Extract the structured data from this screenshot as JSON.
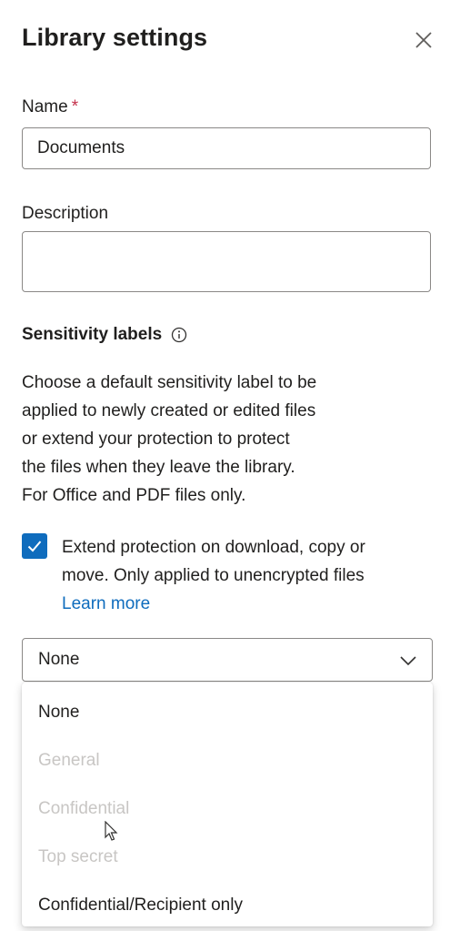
{
  "panel": {
    "title": "Library settings",
    "close_icon": "close-icon"
  },
  "name_field": {
    "label": "Name",
    "required_marker": "*",
    "value": "Documents"
  },
  "description_field": {
    "label": "Description",
    "value": "",
    "placeholder": ""
  },
  "sensitivity": {
    "heading": "Sensitivity labels",
    "info_icon": "info-icon",
    "description_lines": [
      "Choose a default sensitivity label to be",
      "applied to newly created or edited files",
      "or extend your protection to protect",
      "the files when they leave the library.",
      "For Office and PDF files only."
    ],
    "extend_checkbox": {
      "checked": true,
      "lines": [
        "Extend protection on download, copy or",
        "move. Only applied to unencrypted files"
      ],
      "link": "Learn more"
    },
    "dropdown": {
      "selected": "None",
      "options": [
        {
          "label": "None",
          "enabled": true
        },
        {
          "label": "General",
          "enabled": false
        },
        {
          "label": "Confidential",
          "enabled": false
        },
        {
          "label": "Top secret",
          "enabled": false
        },
        {
          "label": "Confidential/Recipient only",
          "enabled": true
        }
      ]
    }
  },
  "colors": {
    "accent": "#0f6cbd",
    "required": "#c4314b",
    "disabled_text": "#c8c6c4",
    "border": "#8a8886"
  }
}
